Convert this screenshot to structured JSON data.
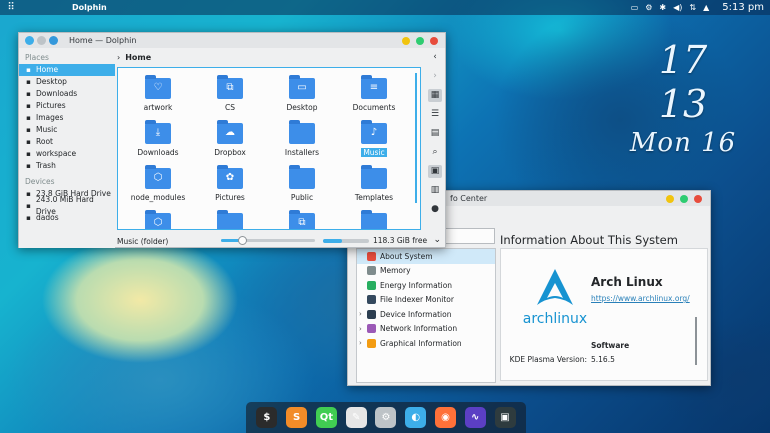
{
  "panel": {
    "launcher_icon": "grid-icon",
    "active_task": "Dolphin",
    "clock": "5:13 pm",
    "tray_icons": [
      "screen-icon",
      "settings-icon",
      "bluetooth-icon",
      "volume-icon",
      "network-icon",
      "caret-up-icon"
    ]
  },
  "desktop_clock": {
    "hour": "17",
    "minute": "13",
    "day": "Mon 16"
  },
  "dolphin": {
    "title": "Home — Dolphin",
    "breadcrumb": "Home",
    "places": {
      "header": "Places",
      "items": [
        {
          "label": "Home",
          "icon": "home-icon",
          "selected": true
        },
        {
          "label": "Desktop",
          "icon": "desktop-icon"
        },
        {
          "label": "Downloads",
          "icon": "download-icon"
        },
        {
          "label": "Pictures",
          "icon": "pictures-icon"
        },
        {
          "label": "Images",
          "icon": "images-icon"
        },
        {
          "label": "Music",
          "icon": "music-icon"
        },
        {
          "label": "Root",
          "icon": "root-icon"
        },
        {
          "label": "workspace",
          "icon": "folder-icon"
        },
        {
          "label": "Trash",
          "icon": "trash-icon"
        }
      ]
    },
    "devices": {
      "header": "Devices",
      "items": [
        {
          "label": "23.8 GiB Hard Drive",
          "icon": "drive-icon"
        },
        {
          "label": "243.0 MiB Hard Drive",
          "icon": "drive-icon"
        },
        {
          "label": "dados",
          "icon": "drive-icon"
        }
      ]
    },
    "files": [
      {
        "label": "artwork",
        "glyph": "♡"
      },
      {
        "label": "CS",
        "glyph": "⧉"
      },
      {
        "label": "Desktop",
        "glyph": "▭"
      },
      {
        "label": "Documents",
        "glyph": "≡"
      },
      {
        "label": "Downloads",
        "glyph": "⤓"
      },
      {
        "label": "Dropbox",
        "glyph": "☁"
      },
      {
        "label": "Installers",
        "glyph": ""
      },
      {
        "label": "Music",
        "glyph": "♪",
        "selected": true
      },
      {
        "label": "node_modules",
        "glyph": "⬡"
      },
      {
        "label": "Pictures",
        "glyph": "✿"
      },
      {
        "label": "Public",
        "glyph": ""
      },
      {
        "label": "Templates",
        "glyph": ""
      },
      {
        "label": "",
        "glyph": "⬡"
      },
      {
        "label": "",
        "glyph": ""
      },
      {
        "label": "",
        "glyph": "⧉"
      },
      {
        "label": "",
        "glyph": ""
      }
    ],
    "status_text": "Music (folder)",
    "zoom_level": 0.22,
    "used_space_fraction": 0.42,
    "free_space": "118.3 GiB free"
  },
  "info_center": {
    "title_fragment": "fo Center",
    "heading": "Information About This System",
    "modules": [
      {
        "label": "About System",
        "selected": true,
        "expandable": false,
        "color": "#e74c3c"
      },
      {
        "label": "Memory",
        "expandable": false,
        "color": "#7f8c8d"
      },
      {
        "label": "Energy Information",
        "expandable": false,
        "color": "#27ae60"
      },
      {
        "label": "File Indexer Monitor",
        "expandable": false,
        "color": "#34495e"
      },
      {
        "label": "Device Information",
        "expandable": true,
        "color": "#2c3e50"
      },
      {
        "label": "Network Information",
        "expandable": true,
        "color": "#9b59b6"
      },
      {
        "label": "Graphical Information",
        "expandable": true,
        "color": "#f39c12"
      }
    ],
    "distro_name": "Arch Linux",
    "distro_url": "https://www.archlinux.org/",
    "logo_text": "archlinux",
    "software_header": "Software",
    "plasma_label": "KDE Plasma Version:",
    "plasma_version": "5.16.5"
  },
  "dock": {
    "apps": [
      {
        "name": "terminal-icon",
        "glyph": "$",
        "color": "#2b2b2b"
      },
      {
        "name": "sublime-text-icon",
        "glyph": "S",
        "color": "#f28c28"
      },
      {
        "name": "qt-creator-icon",
        "glyph": "Qt",
        "color": "#41cd52"
      },
      {
        "name": "inkscape-icon",
        "glyph": "✎",
        "color": "#e6e6e6"
      },
      {
        "name": "system-settings-icon",
        "glyph": "⚙",
        "color": "#bdc3c7"
      },
      {
        "name": "dolphin-icon",
        "glyph": "◐",
        "color": "#3daee9"
      },
      {
        "name": "firefox-icon",
        "glyph": "◉",
        "color": "#ff7139"
      },
      {
        "name": "system-monitor-icon",
        "glyph": "∿",
        "color": "#5b3fc4"
      },
      {
        "name": "resource-monitor-icon",
        "glyph": "▣",
        "color": "#2e3b3e"
      }
    ]
  }
}
